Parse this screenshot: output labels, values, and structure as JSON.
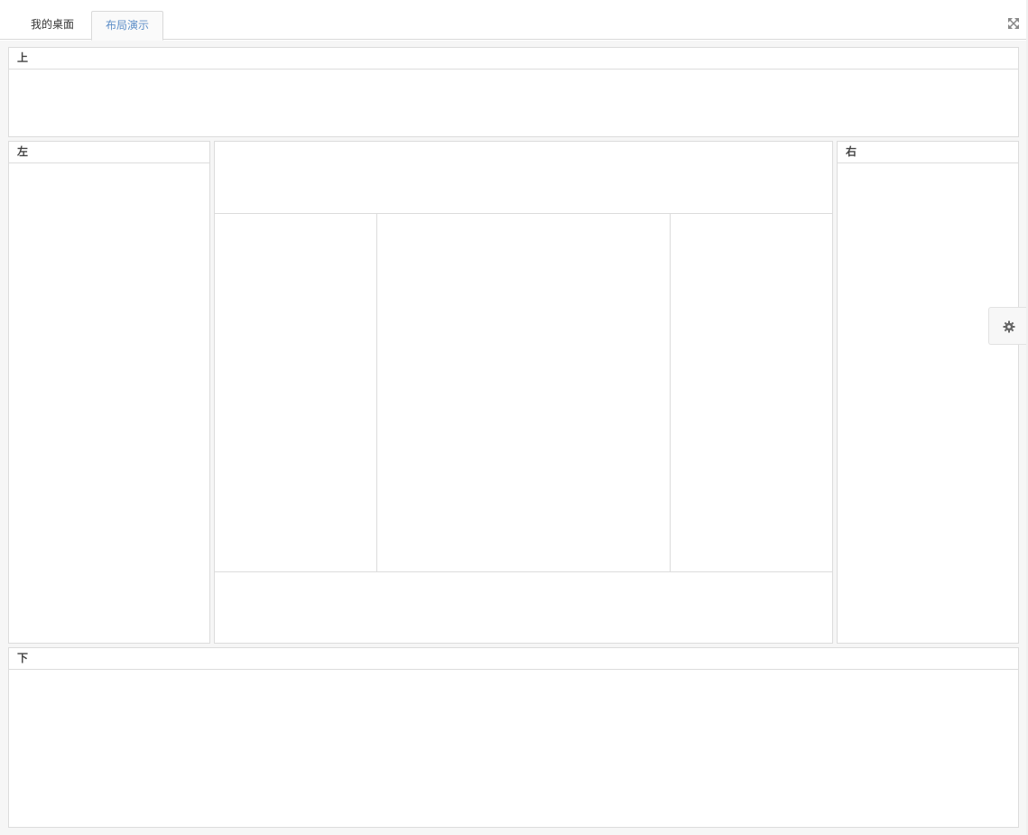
{
  "tabs": [
    {
      "label": "我的桌面",
      "active": false
    },
    {
      "label": "布局演示",
      "active": true
    }
  ],
  "toolbar": {
    "fullscreen_icon": "expand-arrows-icon"
  },
  "layout": {
    "north": {
      "title": "上"
    },
    "west": {
      "title": "左"
    },
    "east": {
      "title": "右"
    },
    "south": {
      "title": "下"
    }
  },
  "settings": {
    "icon": "gear-icon"
  },
  "colors": {
    "active_tab": "#5e8fc8",
    "border": "#dcdcdc"
  }
}
